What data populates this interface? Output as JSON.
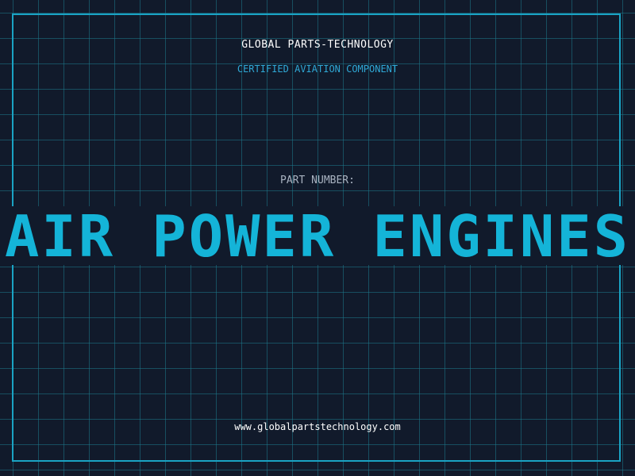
{
  "brand": "GLOBAL PARTS-TECHNOLOGY",
  "subtitle": "CERTIFIED AVIATION COMPONENT",
  "part_number_label": "PART NUMBER:",
  "headline": "AIR POWER ENGINES",
  "website": "www.globalpartstechnology.com",
  "colors": {
    "background": "#111a2b",
    "grid": "#1c788c",
    "accent": "#14b4d8",
    "frame": "#1aa3c4",
    "text": "#ffffff",
    "label": "#a9b3c1"
  }
}
